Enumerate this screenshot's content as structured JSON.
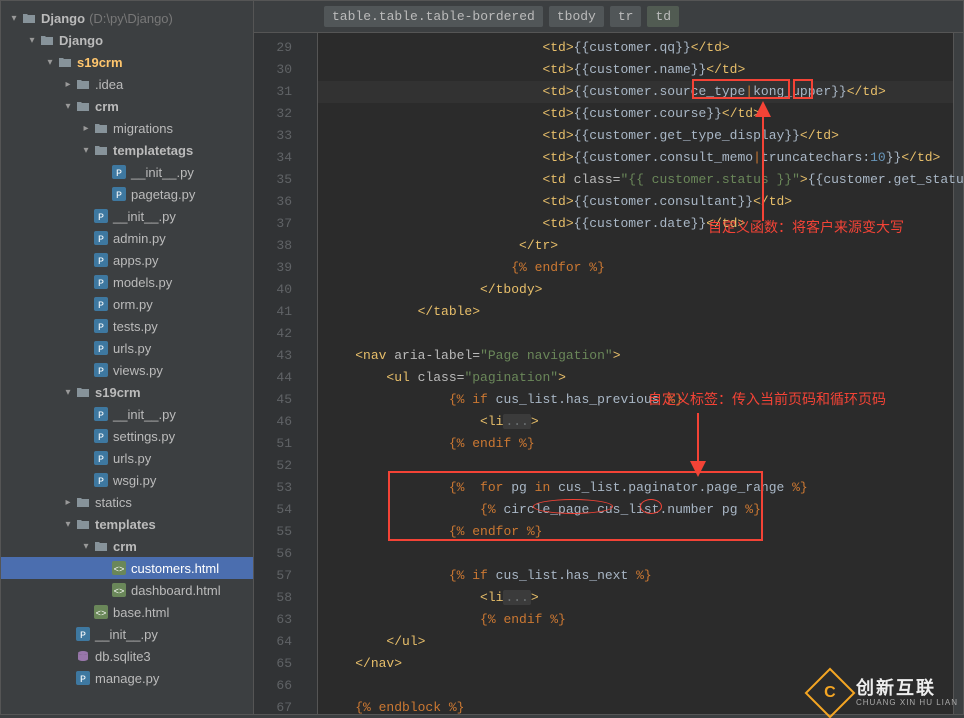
{
  "project": {
    "root": "Django",
    "rootPath": "(D:\\py\\Django)"
  },
  "tree": [
    {
      "depth": 0,
      "arrow": "open",
      "icon": "folder",
      "label": "Django",
      "path": "(D:\\py\\Django)",
      "bold": true
    },
    {
      "depth": 1,
      "arrow": "open",
      "icon": "folder",
      "label": "Django",
      "bold": true
    },
    {
      "depth": 2,
      "arrow": "open",
      "icon": "folder",
      "label": "s19crm",
      "bold": true,
      "highlight": true
    },
    {
      "depth": 3,
      "arrow": "closed",
      "icon": "folder",
      "label": ".idea"
    },
    {
      "depth": 3,
      "arrow": "open",
      "icon": "folder",
      "label": "crm",
      "bold": true
    },
    {
      "depth": 4,
      "arrow": "closed",
      "icon": "folder",
      "label": "migrations"
    },
    {
      "depth": 4,
      "arrow": "open",
      "icon": "folder",
      "label": "templatetags",
      "bold": true
    },
    {
      "depth": 5,
      "arrow": "none",
      "icon": "py",
      "label": "__init__.py"
    },
    {
      "depth": 5,
      "arrow": "none",
      "icon": "py",
      "label": "pagetag.py"
    },
    {
      "depth": 4,
      "arrow": "none",
      "icon": "py",
      "label": "__init__.py"
    },
    {
      "depth": 4,
      "arrow": "none",
      "icon": "py",
      "label": "admin.py"
    },
    {
      "depth": 4,
      "arrow": "none",
      "icon": "py",
      "label": "apps.py"
    },
    {
      "depth": 4,
      "arrow": "none",
      "icon": "py",
      "label": "models.py"
    },
    {
      "depth": 4,
      "arrow": "none",
      "icon": "py",
      "label": "orm.py"
    },
    {
      "depth": 4,
      "arrow": "none",
      "icon": "py",
      "label": "tests.py"
    },
    {
      "depth": 4,
      "arrow": "none",
      "icon": "py",
      "label": "urls.py"
    },
    {
      "depth": 4,
      "arrow": "none",
      "icon": "py",
      "label": "views.py"
    },
    {
      "depth": 3,
      "arrow": "open",
      "icon": "folder",
      "label": "s19crm",
      "bold": true
    },
    {
      "depth": 4,
      "arrow": "none",
      "icon": "py",
      "label": "__init__.py"
    },
    {
      "depth": 4,
      "arrow": "none",
      "icon": "py",
      "label": "settings.py"
    },
    {
      "depth": 4,
      "arrow": "none",
      "icon": "py",
      "label": "urls.py"
    },
    {
      "depth": 4,
      "arrow": "none",
      "icon": "py",
      "label": "wsgi.py"
    },
    {
      "depth": 3,
      "arrow": "closed",
      "icon": "folder",
      "label": "statics"
    },
    {
      "depth": 3,
      "arrow": "open",
      "icon": "folder",
      "label": "templates",
      "bold": true
    },
    {
      "depth": 4,
      "arrow": "open",
      "icon": "folder",
      "label": "crm",
      "bold": true
    },
    {
      "depth": 5,
      "arrow": "none",
      "icon": "html",
      "label": "customers.html",
      "selected": true
    },
    {
      "depth": 5,
      "arrow": "none",
      "icon": "html",
      "label": "dashboard.html"
    },
    {
      "depth": 4,
      "arrow": "none",
      "icon": "html",
      "label": "base.html"
    },
    {
      "depth": 3,
      "arrow": "none",
      "icon": "py",
      "label": "__init__.py"
    },
    {
      "depth": 3,
      "arrow": "none",
      "icon": "db",
      "label": "db.sqlite3"
    },
    {
      "depth": 3,
      "arrow": "none",
      "icon": "py",
      "label": "manage.py"
    }
  ],
  "breadcrumb": [
    {
      "text": "table.table.table-bordered"
    },
    {
      "text": "tbody"
    },
    {
      "text": "tr"
    },
    {
      "text": "td",
      "active": true
    }
  ],
  "gutter_lines": [
    "29",
    "30",
    "31",
    "32",
    "33",
    "34",
    "35",
    "36",
    "37",
    "38",
    "39",
    "40",
    "41",
    "42",
    "43",
    "44",
    "45",
    "46",
    "51",
    "52",
    "53",
    "54",
    "55",
    "56",
    "57",
    "58",
    "63",
    "64",
    "65",
    "66",
    "67"
  ],
  "code": [
    {
      "hl": false,
      "html": "                            <span class='t'>&lt;td&gt;</span><span class='d'>{{customer.qq}}</span><span class='t'>&lt;/td&gt;</span>"
    },
    {
      "hl": false,
      "html": "                            <span class='t'>&lt;td&gt;</span><span class='d'>{{customer.name}}</span><span class='t'>&lt;/td&gt;</span>"
    },
    {
      "hl": true,
      "html": "                            <span class='t'>&lt;td&gt;</span><span class='d'>{{customer.source_type</span><span class='pipe'>|</span><span class='d'>kong_upper}}</span><span class='t'>&lt;/td&gt;</span>"
    },
    {
      "hl": false,
      "html": "                            <span class='t'>&lt;td&gt;</span><span class='d'>{{customer.course}}</span><span class='t'>&lt;/td&gt;</span>"
    },
    {
      "hl": false,
      "html": "                            <span class='t'>&lt;td&gt;</span><span class='d'>{{customer.get_type_display}}</span><span class='t'>&lt;/td&gt;</span>"
    },
    {
      "hl": false,
      "html": "                            <span class='t'>&lt;td&gt;</span><span class='d'>{{customer.consult_memo</span><span class='pipe'>|</span><span class='d'>truncatechars:</span><span class='n'>10</span><span class='d'>}}</span><span class='t'>&lt;/td&gt;</span>"
    },
    {
      "hl": false,
      "html": "                            <span class='t'>&lt;td </span><span class='a'>class=</span><span class='s'>\"{{ customer.status }}\"</span><span class='t'>&gt;</span><span class='d'>{{customer.get_status_display}}</span><span class='t'>&lt;/td&gt;</span>"
    },
    {
      "hl": false,
      "html": "                            <span class='t'>&lt;td&gt;</span><span class='d'>{{customer.consultant}}</span><span class='t'>&lt;/td&gt;</span>"
    },
    {
      "hl": false,
      "html": "                            <span class='t'>&lt;td&gt;</span><span class='d'>{{customer.date}}</span><span class='t'>&lt;/td&gt;</span>"
    },
    {
      "hl": false,
      "html": "                         <span class='t'>&lt;/tr&gt;</span>"
    },
    {
      "hl": false,
      "html": "                        <span class='br'>{%</span><span class='kw'> endfor </span><span class='br'>%}</span>"
    },
    {
      "hl": false,
      "html": "                    <span class='t'>&lt;/tbody&gt;</span>"
    },
    {
      "hl": false,
      "html": "            <span class='t'>&lt;/table&gt;</span>"
    },
    {
      "hl": false,
      "html": ""
    },
    {
      "hl": false,
      "html": "    <span class='t'>&lt;nav </span><span class='a'>aria-label=</span><span class='s'>\"Page navigation\"</span><span class='t'>&gt;</span>"
    },
    {
      "hl": false,
      "html": "        <span class='t'>&lt;ul </span><span class='a'>class=</span><span class='s'>\"pagination\"</span><span class='t'>&gt;</span>"
    },
    {
      "hl": false,
      "html": "                <span class='br'>{%</span><span class='kw'> if </span><span class='d'>cus_list.has_previous </span><span class='br'>%}</span>"
    },
    {
      "hl": false,
      "html": "                    <span class='t'>&lt;li</span><span class='dim'>...</span><span class='t'>&gt;</span>"
    },
    {
      "hl": false,
      "html": "                <span class='br'>{%</span><span class='kw'> endif </span><span class='br'>%}</span>"
    },
    {
      "hl": false,
      "html": ""
    },
    {
      "hl": false,
      "html": "                <span class='br'>{%</span><span class='kw'>  for </span><span class='d'>pg </span><span class='kw'>in </span><span class='d'>cus_list.paginator.page_range </span><span class='br'>%}</span>"
    },
    {
      "hl": false,
      "html": "                    <span class='br'>{%</span><span class='d'> circle_page </span><span class='d'>cus_list.number </span><span class='d'>pg </span><span class='br'>%}</span>"
    },
    {
      "hl": false,
      "html": "                <span class='br'>{%</span><span class='kw'> endfor </span><span class='br'>%}</span>"
    },
    {
      "hl": false,
      "html": ""
    },
    {
      "hl": false,
      "html": "                <span class='br'>{%</span><span class='kw'> if </span><span class='d'>cus_list.has_next </span><span class='br'>%}</span>"
    },
    {
      "hl": false,
      "html": "                    <span class='t'>&lt;li</span><span class='dim'>...</span><span class='t'>&gt;</span>"
    },
    {
      "hl": false,
      "html": "                    <span class='br'>{%</span><span class='kw'> endif </span><span class='br'>%}</span>"
    },
    {
      "hl": false,
      "html": "        <span class='t'>&lt;/ul&gt;</span>"
    },
    {
      "hl": false,
      "html": "    <span class='t'>&lt;/nav&gt;</span>"
    },
    {
      "hl": false,
      "html": ""
    },
    {
      "hl": false,
      "html": "    <span class='br'>{%</span><span class='kw'> endblock </span><span class='br'>%}</span>"
    }
  ],
  "annotations": {
    "note1": "自定义函数：将客户来源变大写",
    "note2": "自定义标签：传入当前页码和循环页码"
  },
  "watermark": {
    "cn": "创新互联",
    "en": "CHUANG XIN HU LIAN"
  }
}
